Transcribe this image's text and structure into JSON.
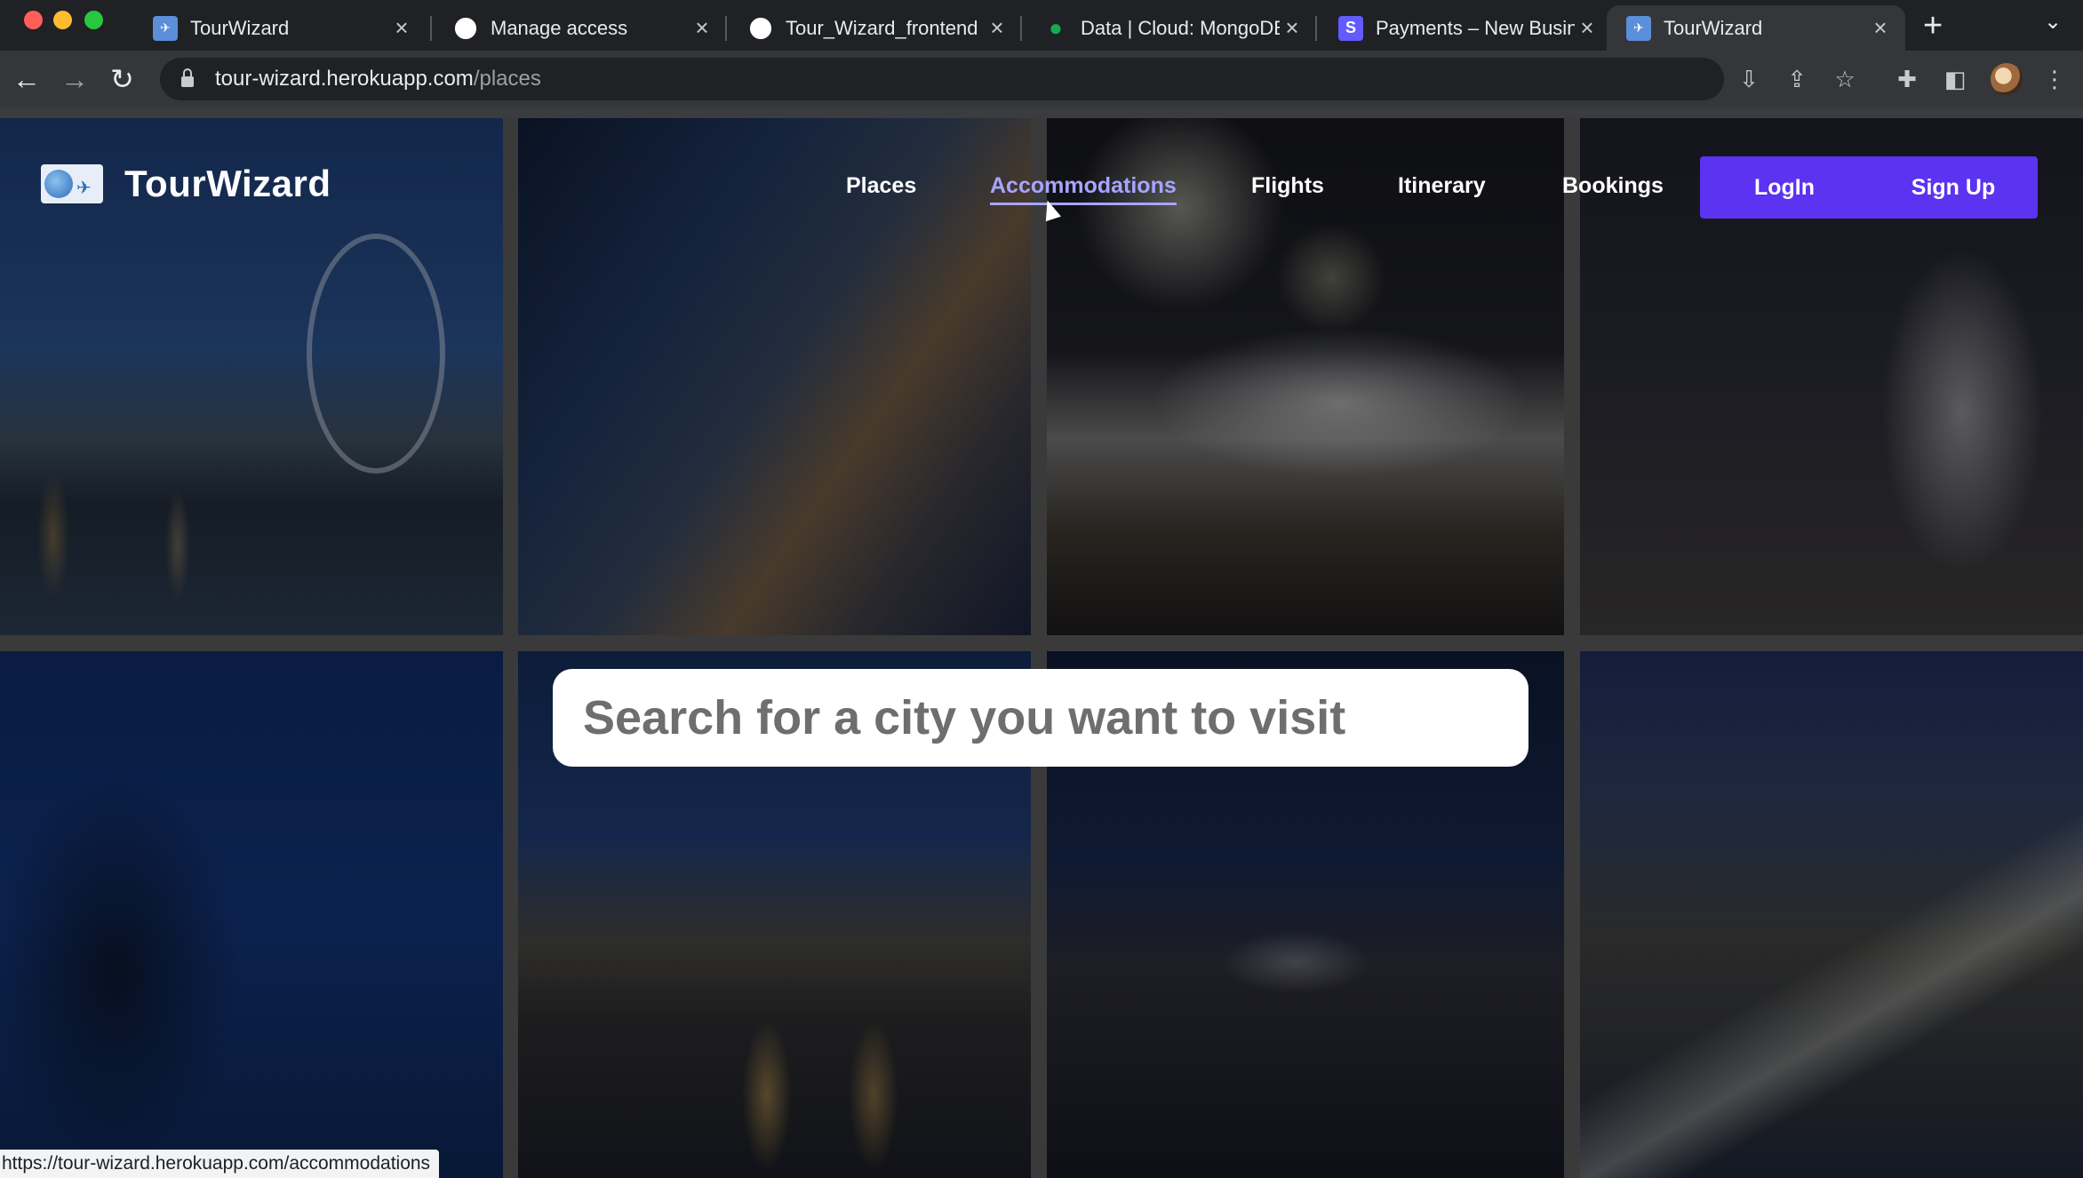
{
  "browser": {
    "tabs": [
      {
        "title": "TourWizard",
        "favicon": "tourwizard-icon",
        "active": false
      },
      {
        "title": "Manage access",
        "favicon": "github-icon",
        "active": false
      },
      {
        "title": "Tour_Wizard_frontend",
        "favicon": "github-icon",
        "active": false
      },
      {
        "title": "Data | Cloud: MongoDB",
        "favicon": "mongodb-leaf-icon",
        "active": false
      },
      {
        "title": "Payments – New Business",
        "favicon": "stripe-icon",
        "active": false
      },
      {
        "title": "TourWizard",
        "favicon": "tourwizard-icon",
        "active": true
      }
    ],
    "stripe_fav": "S",
    "url_host": "tour-wizard.herokuapp.com",
    "url_path": "/places",
    "status_url": "https://tour-wizard.herokuapp.com/accommodations"
  },
  "site": {
    "brand": "TourWizard",
    "nav": [
      {
        "label": "Places",
        "active": false
      },
      {
        "label": "Accommodations",
        "active": true
      },
      {
        "label": "Flights",
        "active": false
      },
      {
        "label": "Itinerary",
        "active": false
      },
      {
        "label": "Bookings",
        "active": false
      }
    ],
    "login_label": "LogIn",
    "signup_label": "Sign Up",
    "search_placeholder": "Search for a city you want to visit",
    "accent_color": "#5b33f0",
    "active_link_color": "#a8a4ff"
  }
}
